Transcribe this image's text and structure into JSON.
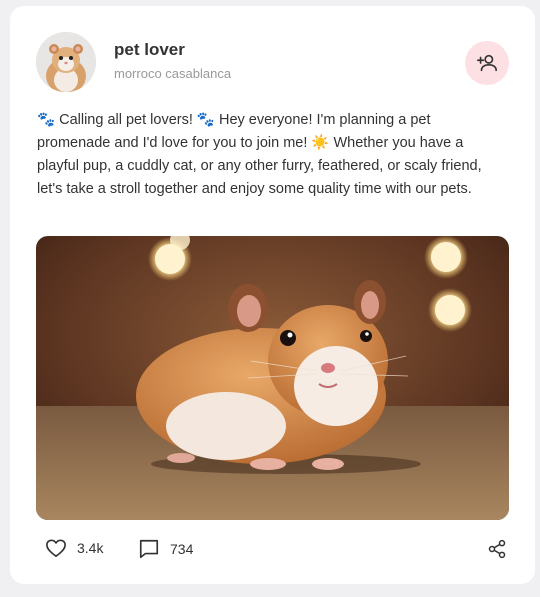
{
  "post": {
    "author": {
      "name": "pet lover",
      "location": "morroco casablanca",
      "avatar_icon": "hamster-avatar"
    },
    "follow_icon": "add-person-icon",
    "text": {
      "paw1": "🐾",
      "part1": " Calling all pet lovers! ",
      "paw2": "🐾",
      "part2": " Hey everyone! I'm planning a pet promenade and I'd love for you to join me! ",
      "sun": "☀️",
      "part3": " Whether you have a playful pup, a cuddly cat, or any other furry, feathered, or scaly friend, let's take a stroll together and enjoy some quality time with our pets."
    },
    "image_subject": "hamster-photo",
    "likes": "3.4k",
    "comments": "734",
    "colors": {
      "follow_bg": "#fde0e4",
      "text": "#333333",
      "muted": "#999999"
    }
  }
}
